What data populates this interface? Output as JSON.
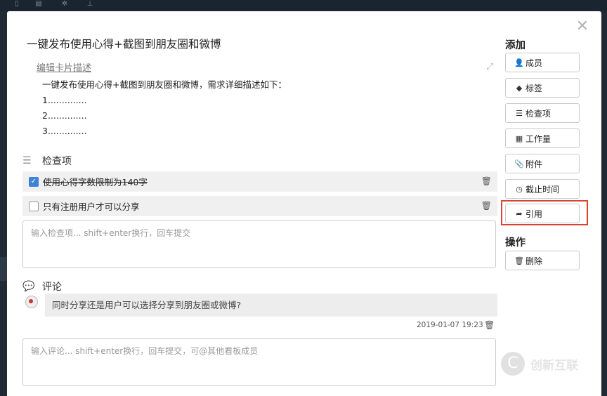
{
  "card": {
    "title": "一键发布使用心得+截图到朋友圈和微博",
    "edit_desc_label": "编辑卡片描述",
    "description_lines": [
      "一键发布使用心得+截图到朋友圈和微博，需求详细描述如下：",
      "1..............",
      "2..............",
      "3.............."
    ]
  },
  "checklist": {
    "heading": "检查项",
    "items": [
      {
        "label": "使用心得字数限制为140字",
        "checked": true
      },
      {
        "label": "只有注册用户才可以分享",
        "checked": false
      }
    ],
    "input_placeholder": "输入检查项... shift+enter换行，回车提交"
  },
  "comments": {
    "heading": "评论",
    "items": [
      {
        "text": "同时分享还是用户可以选择分享到朋友圈或微博?",
        "timestamp": "2019-01-07 19:23"
      }
    ],
    "input_placeholder": "输入评论... shift+enter换行，回车提交，可@其他看板成员"
  },
  "sidebar": {
    "add_heading": "添加",
    "add_buttons": [
      {
        "label": "成员",
        "icon": "add-user-icon"
      },
      {
        "label": "标签",
        "icon": "tag-icon"
      },
      {
        "label": "检查项",
        "icon": "list-icon"
      },
      {
        "label": "工作量",
        "icon": "grid-icon"
      },
      {
        "label": "附件",
        "icon": "paperclip-icon"
      },
      {
        "label": "截止时间",
        "icon": "clock-icon"
      },
      {
        "label": "引用",
        "icon": "share-arrow-icon"
      }
    ],
    "actions_heading": "操作",
    "action_buttons": [
      {
        "label": "删除",
        "icon": "trash-icon"
      }
    ]
  },
  "watermark": {
    "text": "创新互联",
    "logo": "logo-icon"
  },
  "colors": {
    "highlight": "#d9432f",
    "checkbox": "#3b82d8"
  }
}
